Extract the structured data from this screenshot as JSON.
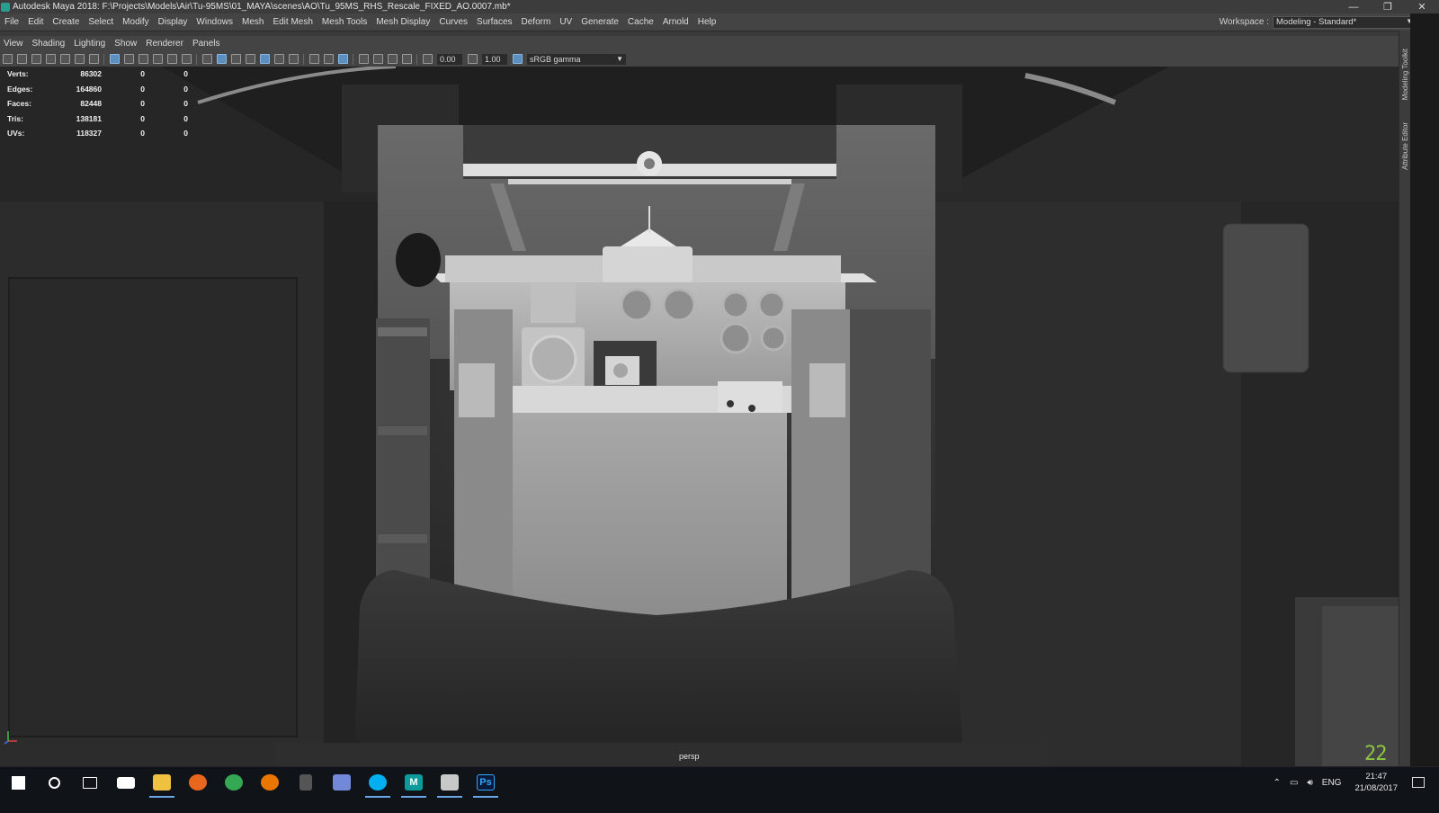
{
  "window": {
    "title": "Autodesk Maya 2018: F:\\Projects\\Models\\Air\\Tu-95MS\\01_MAYA\\scenes\\AO\\Tu_95MS_RHS_Rescale_FIXED_AO.0007.mb*",
    "minimize": "—",
    "restore": "❐",
    "close": "✕"
  },
  "menubar": {
    "items": [
      "File",
      "Edit",
      "Create",
      "Select",
      "Modify",
      "Display",
      "Windows",
      "Mesh",
      "Edit Mesh",
      "Mesh Tools",
      "Mesh Display",
      "Curves",
      "Surfaces",
      "Deform",
      "UV",
      "Generate",
      "Cache",
      "Arnold",
      "Help"
    ],
    "workspace_label": "Workspace :",
    "workspace_value": "Modeling - Standard*"
  },
  "panel_menu": {
    "items": [
      "View",
      "Shading",
      "Lighting",
      "Show",
      "Renderer",
      "Panels"
    ]
  },
  "panel_toolbar": {
    "exposure": "0.00",
    "gamma": "1.00",
    "color_space": "sRGB gamma"
  },
  "hud": {
    "rows": [
      {
        "label": "Verts:",
        "value": "86302",
        "a": "0",
        "b": "0"
      },
      {
        "label": "Edges:",
        "value": "164860",
        "a": "0",
        "b": "0"
      },
      {
        "label": "Faces:",
        "value": "82448",
        "a": "0",
        "b": "0"
      },
      {
        "label": "Tris:",
        "value": "138181",
        "a": "0",
        "b": "0"
      },
      {
        "label": "UVs:",
        "value": "118327",
        "a": "0",
        "b": "0"
      }
    ],
    "camera": "persp",
    "frame": "22"
  },
  "side_tabs": {
    "modeling_toolkit": "Modeling Toolkit",
    "attribute_editor": "Attribute Editor"
  },
  "taskbar": {
    "icons": [
      "windows-start-icon",
      "search-icon",
      "task-view-icon",
      "mail-icon",
      "file-explorer-icon",
      "firefox-icon",
      "chrome-icon",
      "blender-icon",
      "app-icon",
      "discord-icon",
      "skype-icon",
      "maya-icon",
      "app-window-icon",
      "photoshop-icon"
    ],
    "language": "ENG",
    "time": "21:47",
    "date": "21/08/2017"
  }
}
